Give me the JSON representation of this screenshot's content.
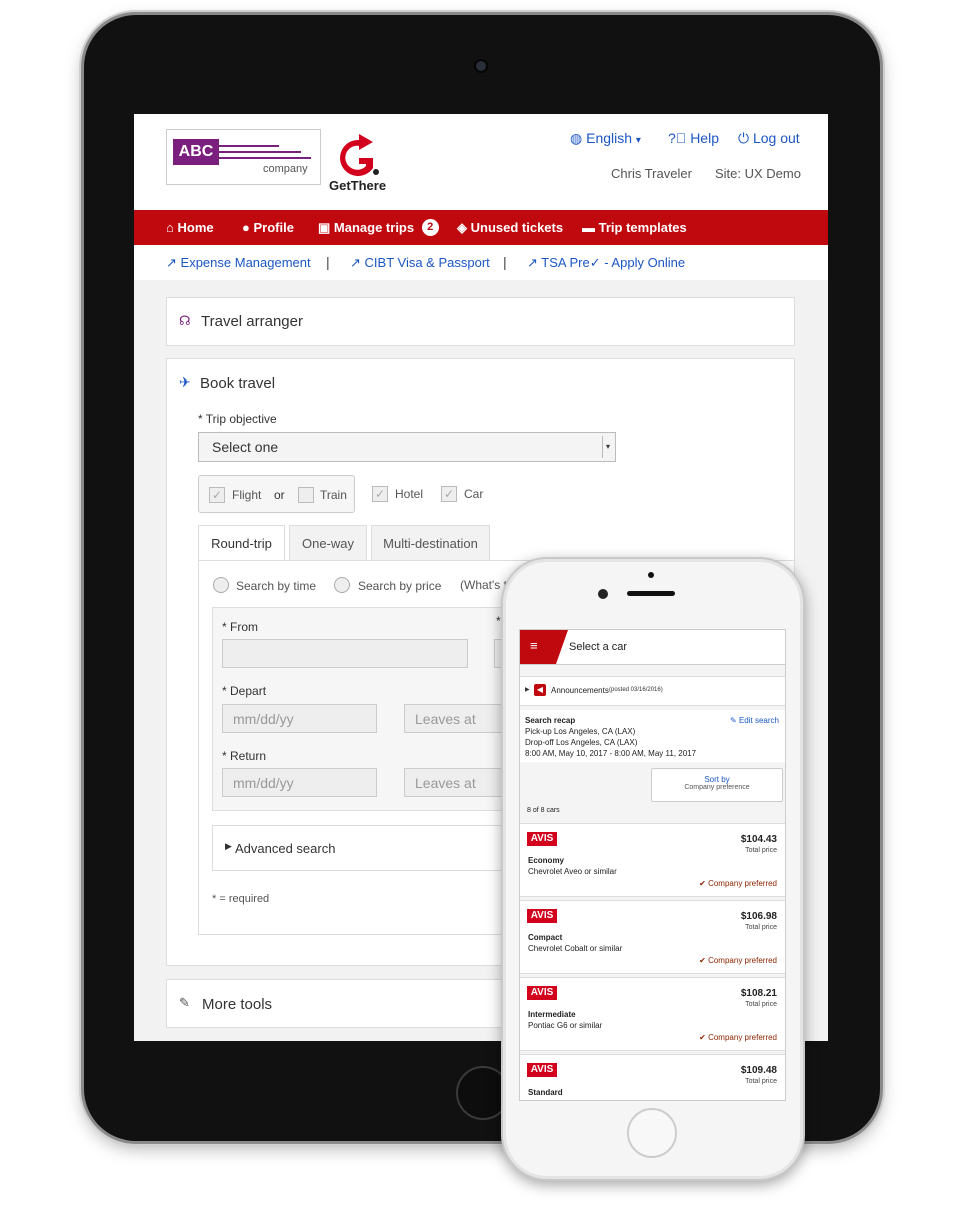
{
  "header": {
    "brand_box": "ABC",
    "brand_company": "company",
    "getthere_logo_text": "GetThere",
    "language": "English",
    "help": "Help",
    "logout": "Log out",
    "user_name": "Chris Traveler",
    "site": "Site: UX Demo"
  },
  "nav": {
    "items": [
      {
        "label": "Home"
      },
      {
        "label": "Profile"
      },
      {
        "label": "Manage trips",
        "badge": "2"
      },
      {
        "label": "Unused tickets"
      },
      {
        "label": "Trip templates"
      }
    ]
  },
  "quick_links": {
    "items": [
      "Expense Management",
      "CIBT Visa & Passport",
      "TSA Pre✓ - Apply Online"
    ],
    "separator": "|"
  },
  "travel_arranger": {
    "title": "Travel arranger"
  },
  "book_travel": {
    "title": "Book travel",
    "trip_objective_label": "* Trip objective",
    "trip_objective_value": "Select one",
    "flight_label": "Flight",
    "or_label": "or",
    "train_label": "Train",
    "hotel_label": "Hotel",
    "car_label": "Car",
    "tabs": [
      "Round-trip",
      "One-way",
      "Multi-destination"
    ],
    "search_by_time": "Search by time",
    "search_by_price": "Search by price",
    "whats_this": "(What's t",
    "from_label": "* From",
    "to_label_fragment": "*",
    "depart_label": "* Depart",
    "return_label": "* Return",
    "date_placeholder": "mm/dd/yy",
    "time_placeholder": "Leaves at",
    "advanced_search": "Advanced search",
    "required_note": "* = required"
  },
  "more_tools": {
    "title": "More tools"
  },
  "mobile": {
    "title": "Select a car",
    "announcements": "Announcements",
    "announcements_date": "(posted 03/16/2016)",
    "recap_title": "Search recap",
    "edit_search": "Edit search",
    "pickup": "Pick-up Los Angeles, CA (LAX)",
    "dropoff": "Drop-off Los Angeles, CA (LAX)",
    "dates": "8:00 AM, May 10, 2017 - 8:00 AM, May 11, 2017",
    "sort_by": "Sort by",
    "sort_value": "Company preference",
    "count": "8 of 8 cars",
    "cars": [
      {
        "vendor": "AVIS",
        "price": "$104.43",
        "price_label": "Total price",
        "class": "Economy",
        "model": "Chevrolet Aveo or similar",
        "preferred": "Company preferred"
      },
      {
        "vendor": "AVIS",
        "price": "$106.98",
        "price_label": "Total price",
        "class": "Compact",
        "model": "Chevrolet Cobalt or similar",
        "preferred": "Company preferred"
      },
      {
        "vendor": "AVIS",
        "price": "$108.21",
        "price_label": "Total price",
        "class": "Intermediate",
        "model": "Pontiac G6 or similar",
        "preferred": "Company preferred"
      },
      {
        "vendor": "AVIS",
        "price": "$109.48",
        "price_label": "Total price",
        "class": "Standard",
        "model": "",
        "preferred": ""
      }
    ]
  },
  "colors": {
    "brand_red": "#c0080f",
    "brand_purple": "#7b1f7f",
    "link_blue": "#1b57c4",
    "avis_red": "#d2001d",
    "preferred_brown": "#8b2500"
  }
}
